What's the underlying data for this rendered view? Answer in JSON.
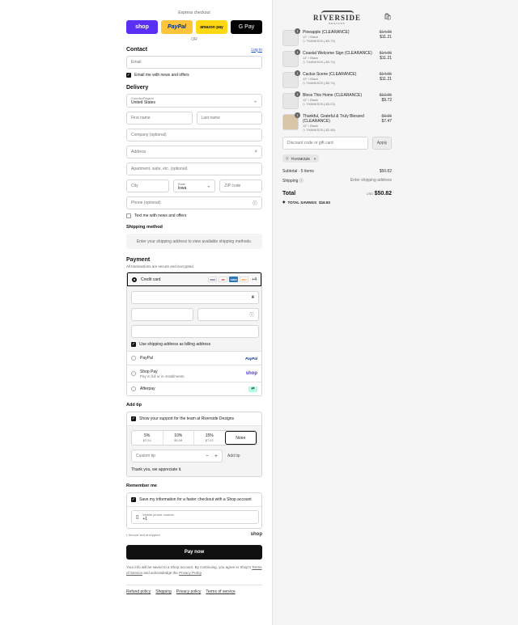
{
  "express": {
    "title": "Express checkout",
    "buttons": [
      "shop",
      "PayPal",
      "amazon pay",
      "G Pay"
    ],
    "or": "OR"
  },
  "contact": {
    "title": "Contact",
    "login": "Log in",
    "email_placeholder": "Email",
    "news_label": "Email me with news and offers"
  },
  "delivery": {
    "title": "Delivery",
    "country_label": "Country/Region",
    "country_value": "United States",
    "first_name": "First name",
    "last_name": "Last name",
    "company": "Company (optional)",
    "address": "Address",
    "apartment": "Apartment, suite, etc. (optional)",
    "city": "City",
    "state_label": "State",
    "state_value": "Iowa",
    "zip": "ZIP code",
    "phone": "Phone (optional)",
    "text_label": "Text me with news and offers"
  },
  "shipping": {
    "title": "Shipping method",
    "message": "Enter your shipping address to view available shipping methods."
  },
  "payment": {
    "title": "Payment",
    "subtitle": "All transactions are secure and encrypted.",
    "credit_card": "Credit card",
    "card_brands": [
      "VISA",
      "MC",
      "AMEX",
      "DISC"
    ],
    "more_cards": "+4",
    "billing_label": "Use shipping address as billing address",
    "paypal": "PayPal",
    "paypal_logo": "PayPal",
    "shop_pay": "Shop Pay",
    "shop_pay_sub": "Pay in full or in installments",
    "shop_logo": "shop",
    "afterpay": "Afterpay"
  },
  "tip": {
    "title": "Add tip",
    "support_label": "Show your support for the team at Riverside Designs",
    "options": [
      {
        "pct": "5%",
        "amount": "$2.54"
      },
      {
        "pct": "10%",
        "amount": "$5.08"
      },
      {
        "pct": "15%",
        "amount": "$7.62"
      },
      {
        "pct": "None",
        "amount": ""
      }
    ],
    "custom_placeholder": "Custom tip",
    "add_button": "Add tip",
    "thanks": "Thank you, we appreciate it."
  },
  "remember": {
    "title": "Remember me",
    "save_label": "Save my information for a faster checkout with a Shop account",
    "phone_label": "Mobile phone number",
    "phone_value": "+1",
    "secure": "Secure and encrypted",
    "shop_logo": "shop"
  },
  "pay_now": "Pay now",
  "legal": {
    "line1": "Your info will be saved to a Shop account. By continuing, you agree to Shop's",
    "terms": "Terms of Service",
    "middle": "and acknowledge the",
    "privacy": "Privacy Policy",
    "end": "."
  },
  "footer_links": [
    "Refund policy",
    "Shipping",
    "Privacy policy",
    "Terms of service"
  ],
  "store": {
    "logo": "RIVERSIDE",
    "logo_sub": "DESIGNS"
  },
  "items": [
    {
      "qty": "1",
      "name": "Pineapple (CLEARANCE)",
      "variant": "12\" / Black",
      "discount": "THANKS25 (-$3.74)",
      "old": "$14.95",
      "price": "$11.21"
    },
    {
      "qty": "1",
      "name": "Coastal Welcome Sign (CLEARANCE)",
      "variant": "12\" / Black",
      "discount": "THANKS25 (-$3.74)",
      "old": "$14.95",
      "price": "$11.21"
    },
    {
      "qty": "1",
      "name": "Cactus Scene (CLEARANCE)",
      "variant": "12\" / Black",
      "discount": "THANKS25 (-$3.74)",
      "old": "$14.95",
      "price": "$11.21"
    },
    {
      "qty": "1",
      "name": "Bless This Home (CLEARANCE)",
      "variant": "12\" / Black",
      "discount": "THANKS25 (-$3.23)",
      "old": "$12.95",
      "price": "$9.72"
    },
    {
      "qty": "1",
      "name": "Thankful, Grateful & Truly Blessed (CLEARANCE)",
      "variant": "12\" / Black",
      "discount": "THANKS25 (-$2.48)",
      "old": "$9.95",
      "price": "$7.47"
    }
  ],
  "discount": {
    "placeholder": "Discount code or gift card",
    "apply": "Apply",
    "code": "THANKS25"
  },
  "summary": {
    "subtotal_label": "Subtotal · 5 items",
    "subtotal": "$50.82",
    "shipping_label": "Shipping",
    "shipping_value": "Enter shipping address",
    "total_label": "Total",
    "currency": "USD",
    "total": "$50.82",
    "savings_label": "TOTAL SAVINGS",
    "savings": "$16.93"
  }
}
